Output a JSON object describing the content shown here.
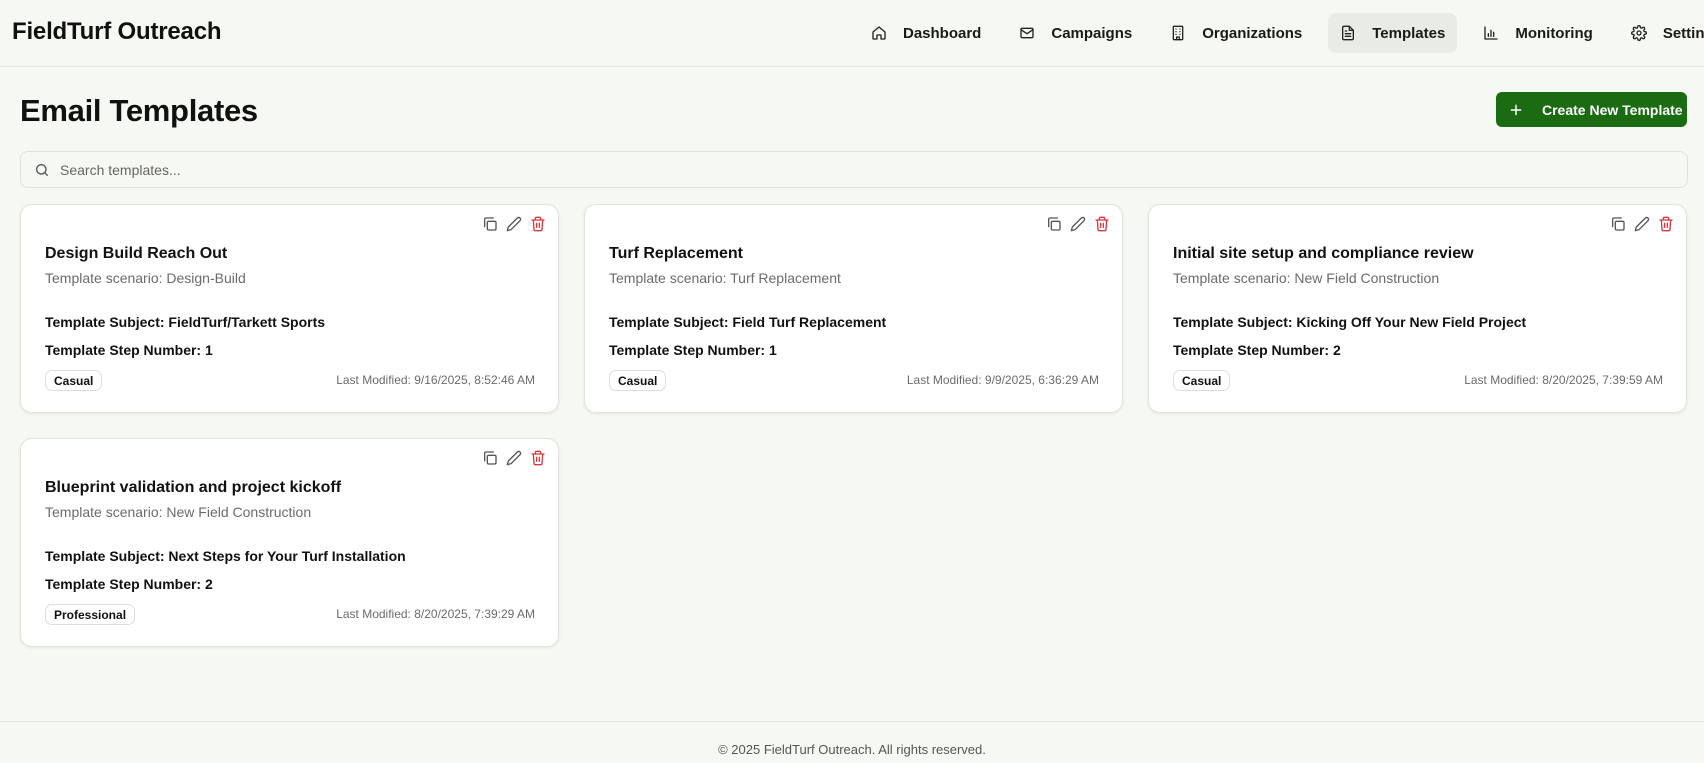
{
  "app": {
    "title": "FieldTurf Outreach"
  },
  "nav": {
    "items": [
      {
        "label": "Dashboard",
        "icon": "home-icon"
      },
      {
        "label": "Campaigns",
        "icon": "mail-icon"
      },
      {
        "label": "Organizations",
        "icon": "building-icon"
      },
      {
        "label": "Templates",
        "icon": "file-text-icon",
        "active": true
      },
      {
        "label": "Monitoring",
        "icon": "bar-chart-icon"
      },
      {
        "label": "Settings",
        "icon": "gear-icon"
      }
    ]
  },
  "page": {
    "title": "Email Templates",
    "create_button": "Create New Template"
  },
  "search": {
    "placeholder": "Search templates..."
  },
  "templates": [
    {
      "title": "Design Build Reach Out",
      "scenario": "Template scenario: Design-Build",
      "subject": "Template Subject: FieldTurf/Tarkett Sports",
      "step": "Template Step Number: 1",
      "tone": "Casual",
      "modified": "Last Modified: 9/16/2025, 8:52:46 AM"
    },
    {
      "title": "Turf Replacement",
      "scenario": "Template scenario: Turf Replacement",
      "subject": "Template Subject: Field Turf Replacement",
      "step": "Template Step Number: 1",
      "tone": "Casual",
      "modified": "Last Modified: 9/9/2025, 6:36:29 AM"
    },
    {
      "title": "Initial site setup and compliance review",
      "scenario": "Template scenario: New Field Construction",
      "subject": "Template Subject: Kicking Off Your New Field Project",
      "step": "Template Step Number: 2",
      "tone": "Casual",
      "modified": "Last Modified: 8/20/2025, 7:39:59 AM"
    },
    {
      "title": "Blueprint validation and project kickoff",
      "scenario": "Template scenario: New Field Construction",
      "subject": "Template Subject: Next Steps for Your Turf Installation",
      "step": "Template Step Number: 2",
      "tone": "Professional",
      "modified": "Last Modified: 8/20/2025, 7:39:29 AM"
    }
  ],
  "footer": {
    "text": "© 2025 FieldTurf Outreach. All rights reserved."
  },
  "colors": {
    "background": "#f6f8f3",
    "primary": "#1b6b12",
    "danger": "#d9363e",
    "muted": "#6b6b6b"
  }
}
